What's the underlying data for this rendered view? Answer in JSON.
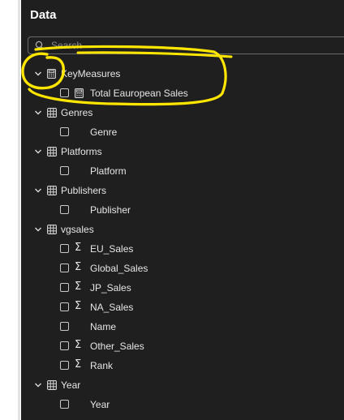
{
  "panel": {
    "title": "Data",
    "search": {
      "placeholder": "Search",
      "value": ""
    }
  },
  "tree": {
    "key_measures": {
      "label": "KeyMeasures",
      "fields": [
        "Total Eauropean Sales"
      ]
    },
    "genres": {
      "label": "Genres",
      "fields": [
        "Genre"
      ]
    },
    "platforms": {
      "label": "Platforms",
      "fields": [
        "Platform"
      ]
    },
    "publishers": {
      "label": "Publishers",
      "fields": [
        "Publisher"
      ]
    },
    "vgsales": {
      "label": "vgsales",
      "fields": [
        {
          "label": "EU_Sales",
          "icon": "sigma-icon"
        },
        {
          "label": "Global_Sales",
          "icon": "sigma-icon"
        },
        {
          "label": "JP_Sales",
          "icon": "sigma-icon"
        },
        {
          "label": "NA_Sales",
          "icon": "sigma-icon"
        },
        {
          "label": "Name",
          "icon": "none"
        },
        {
          "label": "Other_Sales",
          "icon": "sigma-icon"
        },
        {
          "label": "Rank",
          "icon": "sigma-icon"
        }
      ]
    },
    "year": {
      "label": "Year",
      "fields": [
        "Year"
      ]
    }
  },
  "colors": {
    "panel_bg": "#1f1f1f",
    "text": "#e6e6e6",
    "annotation": "#ffe600"
  }
}
